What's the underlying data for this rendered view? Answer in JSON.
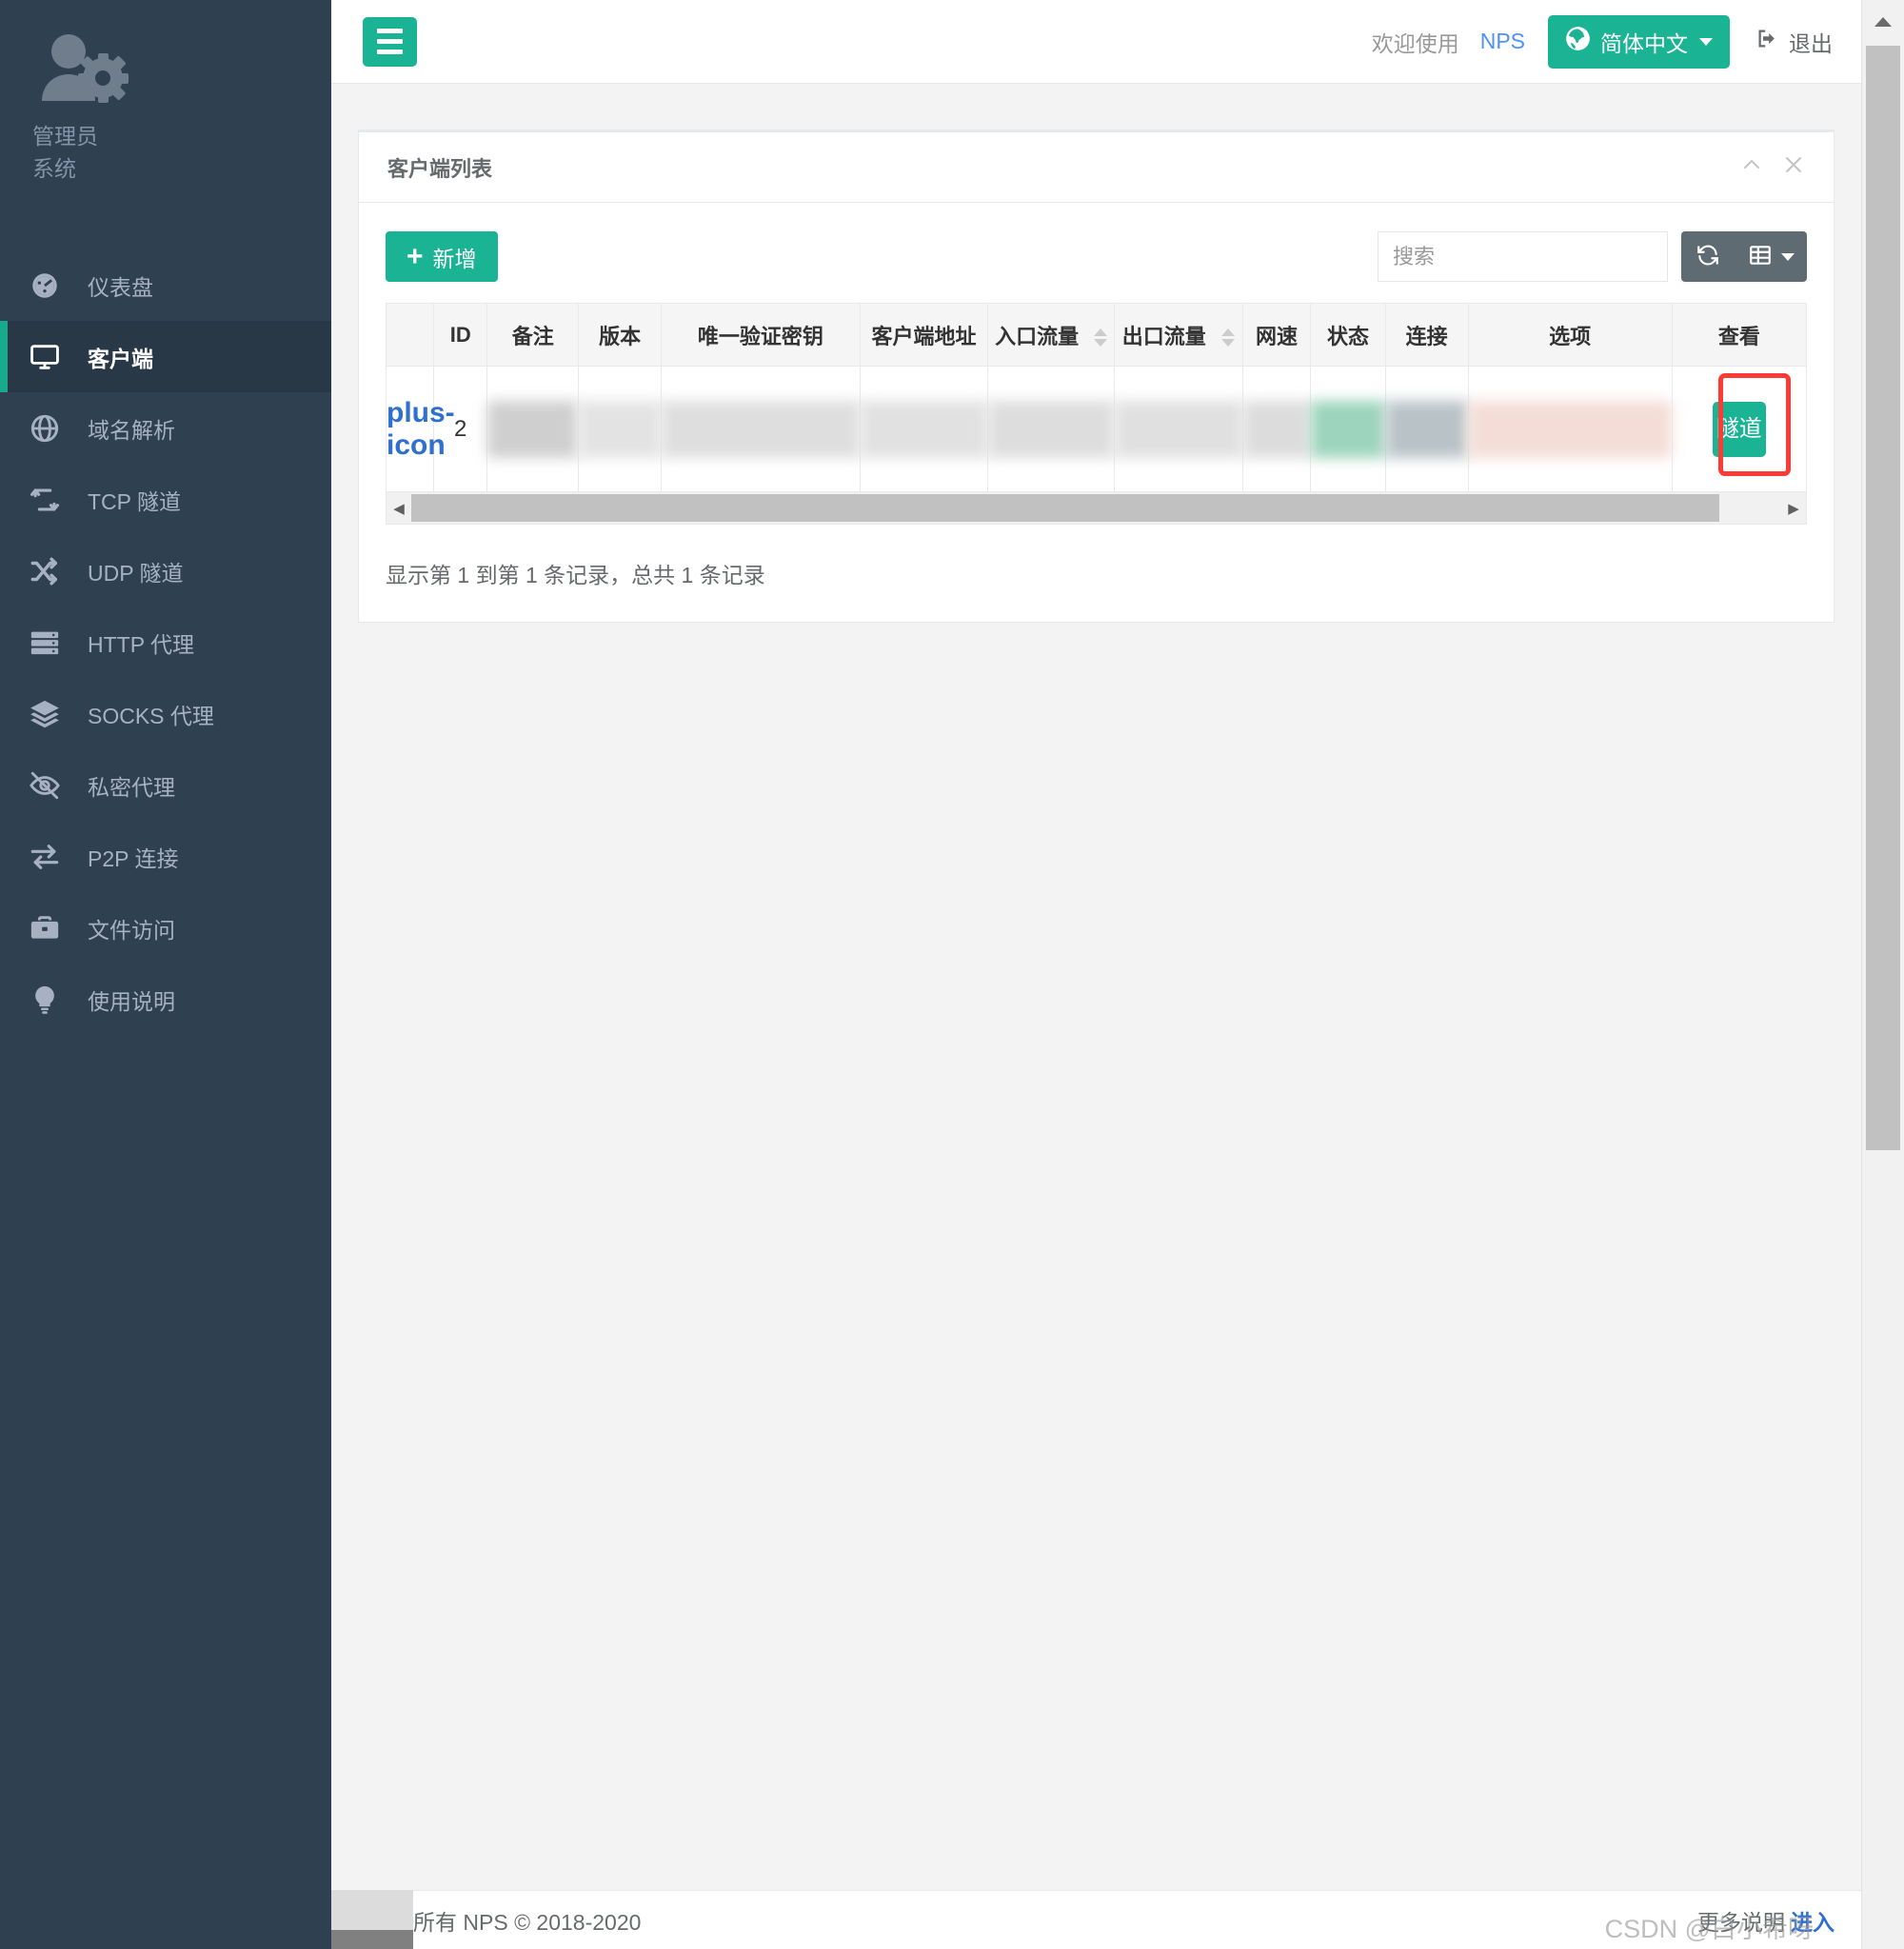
{
  "sidebar": {
    "profile": {
      "name": "管理员",
      "sub": "系统",
      "avatar_icon": "user-gear-icon"
    },
    "items": [
      {
        "label": "仪表盘",
        "icon": "dashboard-icon",
        "active": false
      },
      {
        "label": "客户端",
        "icon": "monitor-icon",
        "active": true
      },
      {
        "label": "域名解析",
        "icon": "globe-icon",
        "active": false
      },
      {
        "label": "TCP 隧道",
        "icon": "exchange-arrows-icon",
        "active": false
      },
      {
        "label": "UDP 隧道",
        "icon": "shuffle-icon",
        "active": false
      },
      {
        "label": "HTTP 代理",
        "icon": "server-icon",
        "active": false
      },
      {
        "label": "SOCKS 代理",
        "icon": "layers-icon",
        "active": false
      },
      {
        "label": "私密代理",
        "icon": "eye-slash-icon",
        "active": false
      },
      {
        "label": "P2P 连接",
        "icon": "two-arrows-icon",
        "active": false
      },
      {
        "label": "文件访问",
        "icon": "briefcase-icon",
        "active": false
      },
      {
        "label": "使用说明",
        "icon": "lightbulb-icon",
        "active": false
      }
    ]
  },
  "topbar": {
    "menu_toggle_icon": "hamburger-icon",
    "welcome": "欢迎使用",
    "app_link": "NPS",
    "language_label": "简体中文",
    "language_icon": "globe-icon",
    "logout_label": "退出",
    "logout_icon": "sign-out-icon"
  },
  "panel": {
    "title": "客户端列表",
    "collapse_icon": "chevron-up-icon",
    "close_icon": "close-icon"
  },
  "toolbar": {
    "add_label": "新增",
    "add_icon": "plus-icon",
    "search_placeholder": "搜索",
    "search_value": "",
    "refresh_icon": "refresh-icon",
    "columns_icon": "table-columns-icon",
    "columns_caret_icon": "chevron-down-icon"
  },
  "table": {
    "columns": [
      {
        "label": "",
        "sortable": false
      },
      {
        "label": "ID",
        "sortable": false
      },
      {
        "label": "备注",
        "sortable": false
      },
      {
        "label": "版本",
        "sortable": false
      },
      {
        "label": "唯一验证密钥",
        "sortable": false
      },
      {
        "label": "客户端地址",
        "sortable": false
      },
      {
        "label": "入口流量",
        "sortable": true
      },
      {
        "label": "出口流量",
        "sortable": true
      },
      {
        "label": "网速",
        "sortable": false
      },
      {
        "label": "状态",
        "sortable": false
      },
      {
        "label": "连接",
        "sortable": false
      },
      {
        "label": "选项",
        "sortable": false
      },
      {
        "label": "查看",
        "sortable": false
      }
    ],
    "rows": [
      {
        "expand_icon": "plus-icon",
        "id": "2",
        "remark": "",
        "version": "",
        "vkey": "",
        "address": "",
        "in_traffic": "",
        "out_traffic": "",
        "speed": "",
        "status": "",
        "connection": "",
        "options": "",
        "view_button": "隧道"
      }
    ],
    "info_text": "显示第 1 到第 1 条记录，总共 1 条记录",
    "scroll_left_icon": "chevron-left-icon",
    "scroll_right_icon": "chevron-right-icon"
  },
  "highlight": {
    "target": "隧道",
    "color": "#fc3a36"
  },
  "footer": {
    "left_text": "所有 NPS © 2018-2020",
    "right_text": "更多说明",
    "right_link": "进入",
    "watermark": "CSDN @白小希呀"
  },
  "colors": {
    "sidebar_bg": "#2f4050",
    "sidebar_active_bg": "#293846",
    "accent_green": "#1ab394",
    "link_blue": "#4d90fe",
    "highlight_red": "#fc3a36"
  }
}
